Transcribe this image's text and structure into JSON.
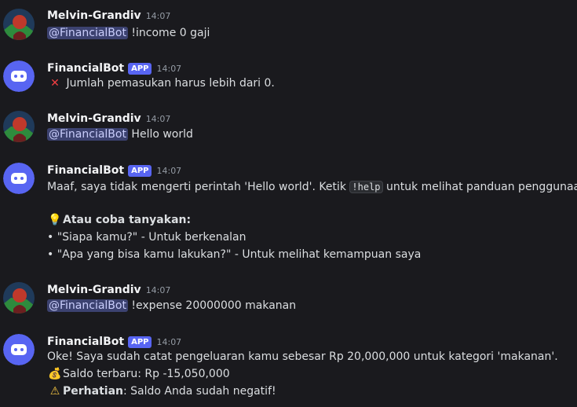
{
  "bot": {
    "name": "FinancialBot",
    "tag": "APP"
  },
  "user": {
    "name": "Melvin-Grandiv"
  },
  "messages": [
    {
      "author": "Melvin-Grandiv",
      "time": "14:07",
      "mention": "@FinancialBot",
      "text": "!income 0 gaji"
    },
    {
      "author": "FinancialBot",
      "time": "14:07",
      "icon": "cross-mark-icon",
      "text": "Jumlah pemasukan harus lebih dari 0."
    },
    {
      "author": "Melvin-Grandiv",
      "time": "14:07",
      "mention": "@FinancialBot",
      "text": "Hello world"
    },
    {
      "author": "FinancialBot",
      "time": "14:07",
      "line1_pre": "Maaf, saya tidak mengerti perintah 'Hello world'. Ketik ",
      "line1_code": "!help",
      "line1_post": " untuk melihat panduan penggunaan.",
      "tip_icon": "light-bulb-icon",
      "tip_heading": "Atau coba tanyakan:",
      "bullets": [
        "• \"Siapa kamu?\" - Untuk berkenalan",
        "• \"Apa yang bisa kamu lakukan?\" - Untuk melihat kemampuan saya"
      ]
    },
    {
      "author": "Melvin-Grandiv",
      "time": "14:07",
      "mention": "@FinancialBot",
      "text": "!expense 20000000 makanan"
    },
    {
      "author": "FinancialBot",
      "time": "14:07",
      "text": "Oke! Saya sudah catat pengeluaran kamu sebesar Rp 20,000,000 untuk kategori 'makanan'.",
      "balance_icon": "money-bag-icon",
      "balance_text": "Saldo terbaru: Rp -15,050,000",
      "warning_icon": "warning-icon",
      "warning_label": "Perhatian",
      "warning_text": ": Saldo Anda sudah negatif!"
    }
  ],
  "colors": {
    "background": "#1a1a1e",
    "mention_bg": "#3c4270",
    "app_tag": "#5865f2",
    "bot_avatar": "#5865f2",
    "error": "#f23f43"
  }
}
